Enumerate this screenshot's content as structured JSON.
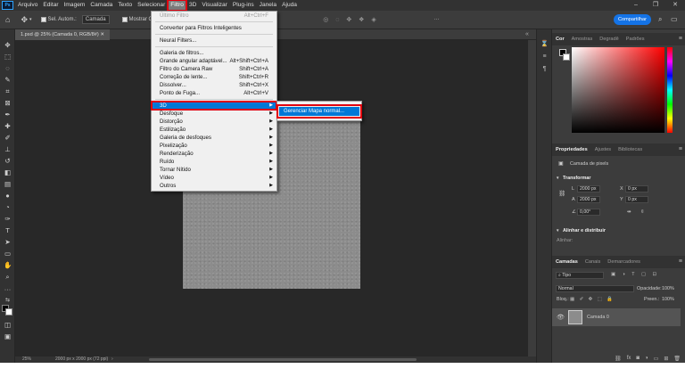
{
  "menubar": {
    "logo": "Ps",
    "items": [
      "Arquivo",
      "Editar",
      "Imagem",
      "Camada",
      "Texto",
      "Selecionar",
      "Filtro",
      "3D",
      "Visualizar",
      "Plug-ins",
      "Janela",
      "Ajuda"
    ]
  },
  "options": {
    "sample_all": "Sel. Autom.:",
    "layer_select": "Camada",
    "show_controls": "Mostrar Co"
  },
  "share_button": "Compartilhar",
  "document_tab": "1.psd @ 25% (Camada 0, RGB/8#)",
  "status": {
    "zoom": "25%",
    "doc_size": "2000 px x 2000 px (72 ppi)"
  },
  "filter_menu": {
    "items": [
      {
        "label": "Último Filtro",
        "shortcut": "Alt+Ctrl+F"
      },
      {
        "label": "Converter para Filtros Inteligentes",
        "shortcut": ""
      },
      {
        "label": "Neural Filters...",
        "shortcut": ""
      },
      {
        "label": "Galeria de filtros...",
        "shortcut": ""
      },
      {
        "label": "Grande angular adaptável...",
        "shortcut": "Alt+Shift+Ctrl+A"
      },
      {
        "label": "Filtro do Camera Raw",
        "shortcut": "Shift+Ctrl+A"
      },
      {
        "label": "Correção de lente...",
        "shortcut": "Shift+Ctrl+R"
      },
      {
        "label": "Dissolver...",
        "shortcut": "Shift+Ctrl+X"
      },
      {
        "label": "Ponto de Fuga...",
        "shortcut": "Alt+Ctrl+V"
      },
      {
        "label": "3D",
        "shortcut": ""
      },
      {
        "label": "Desfoque",
        "shortcut": ""
      },
      {
        "label": "Distorção",
        "shortcut": ""
      },
      {
        "label": "Estilização",
        "shortcut": ""
      },
      {
        "label": "Galeria de desfoques",
        "shortcut": ""
      },
      {
        "label": "Pixelização",
        "shortcut": ""
      },
      {
        "label": "Renderização",
        "shortcut": ""
      },
      {
        "label": "Ruído",
        "shortcut": ""
      },
      {
        "label": "Tornar Nítido",
        "shortcut": ""
      },
      {
        "label": "Vídeo",
        "shortcut": ""
      },
      {
        "label": "Outros",
        "shortcut": ""
      }
    ]
  },
  "submenu_3d": {
    "item": "Gerenciar Mapa normal..."
  },
  "color_panel": {
    "tabs": [
      "Cor",
      "Amostras",
      "Degradê",
      "Padrões"
    ]
  },
  "properties_panel": {
    "tabs": [
      "Propriedades",
      "Ajustes",
      "Bibliotecas"
    ],
    "layer_type": "Camada de pixels",
    "transform_title": "Transformar",
    "w_label": "L",
    "w_value": "2000 px",
    "h_label": "A",
    "h_value": "2000 px",
    "x_label": "X",
    "x_value": "0 px",
    "y_label": "Y",
    "y_value": "0 px",
    "angle_value": "0,00°",
    "align_title": "Alinhar e distribuir",
    "align_label": "Alinhar:"
  },
  "layers_panel": {
    "tabs": [
      "Camadas",
      "Canais",
      "Demarcadores"
    ],
    "filter_kind": "Tipo",
    "blend_mode": "Normal",
    "opacity_label": "Opacidade:",
    "opacity_value": "100%",
    "lock_label": "Bloq.:",
    "fill_label": "Preen.:",
    "fill_value": "100%",
    "layer_name": "Camada 0"
  }
}
